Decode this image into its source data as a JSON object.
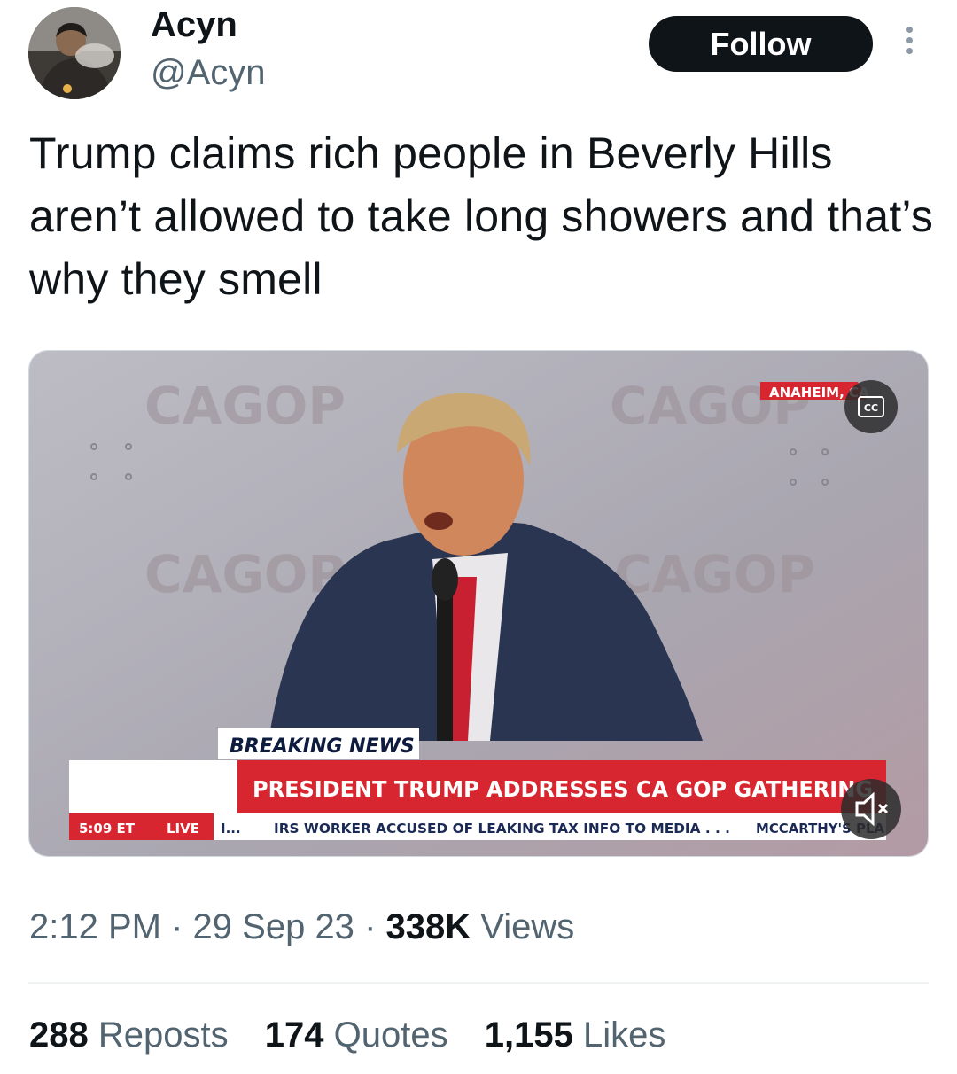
{
  "author": {
    "name": "Acyn",
    "handle": "@Acyn",
    "follow_label": "Follow"
  },
  "tweet": {
    "text": "Trump claims rich people in Beverly Hills aren’t allowed to take long showers and that’s why they smell"
  },
  "video": {
    "backdrop_logo": "CAGOP",
    "location_tag": "ANAHEIM, CA",
    "cc_label": "CC",
    "breaking_label": "BREAKING NEWS",
    "headline": "PRESIDENT TRUMP ADDRESSES CA GOP GATHERING",
    "time": "5:09 ET",
    "live": "LIVE",
    "ticker_1": "I...",
    "ticker_2": "IRS WORKER ACCUSED OF LEAKING TAX INFO TO MEDIA . . .",
    "ticker_3": "MCCARTHY'S PLA",
    "muted": true
  },
  "meta": {
    "time": "2:12 PM",
    "sep": "·",
    "date": "29 Sep 23",
    "views_count": "338K",
    "views_label": "Views"
  },
  "stats": {
    "reposts_count": "288",
    "reposts_label": "Reposts",
    "quotes_count": "174",
    "quotes_label": "Quotes",
    "likes_count": "1,155",
    "likes_label": "Likes"
  },
  "colors": {
    "accent_red": "#d7262f",
    "follow_bg": "#0f1419",
    "secondary_text": "#536471"
  }
}
